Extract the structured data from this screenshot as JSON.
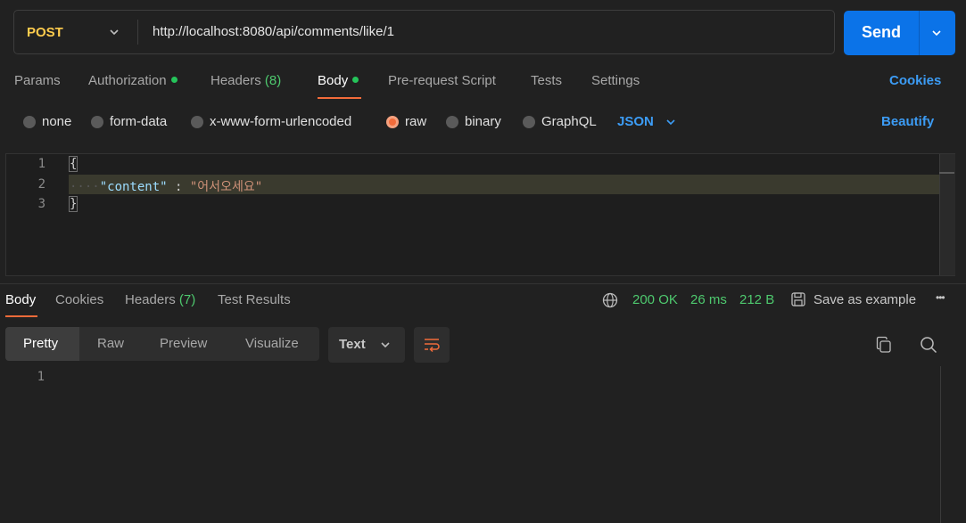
{
  "request": {
    "method": "POST",
    "url": "http://localhost:8080/api/comments/like/1",
    "send_label": "Send"
  },
  "tabs": {
    "params": "Params",
    "authorization": "Authorization",
    "headers": "Headers",
    "headers_count": "(8)",
    "body": "Body",
    "prerequest": "Pre-request Script",
    "tests": "Tests",
    "settings": "Settings",
    "cookies": "Cookies"
  },
  "body_types": {
    "none": "none",
    "form_data": "form-data",
    "urlencoded": "x-www-form-urlencoded",
    "raw": "raw",
    "binary": "binary",
    "graphql": "GraphQL",
    "format": "JSON",
    "beautify": "Beautify",
    "selected": "raw"
  },
  "editor": {
    "lines": [
      "1",
      "2",
      "3"
    ],
    "open_brace": "{",
    "indent": "····",
    "key": "\"content\"",
    "colon": " : ",
    "value": "\"어서오세요\"",
    "close_brace": "}"
  },
  "response": {
    "tabs": {
      "body": "Body",
      "cookies": "Cookies",
      "headers": "Headers",
      "headers_count": "(7)",
      "test_results": "Test Results"
    },
    "status": "200 OK",
    "time": "26 ms",
    "size": "212 B",
    "save_example": "Save as example",
    "more": "•••",
    "views": {
      "pretty": "Pretty",
      "raw": "Raw",
      "preview": "Preview",
      "visualize": "Visualize"
    },
    "text_format": "Text",
    "line": "1"
  },
  "colors": {
    "method": "#ffcc4d",
    "send": "#0b73e8",
    "accent": "#f26b3a",
    "status_green": "#4ec96e",
    "link": "#3c9cf5"
  }
}
